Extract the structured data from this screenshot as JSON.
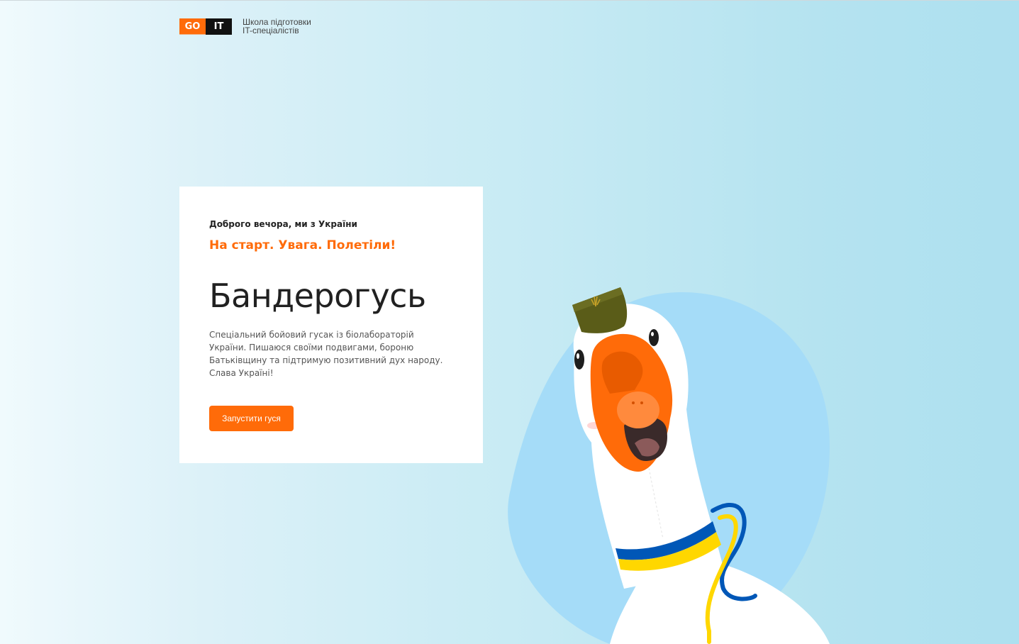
{
  "header": {
    "logo_go": "GO",
    "logo_it": "IT",
    "tagline_line1": "Школа підготовки",
    "tagline_line2": "IT-спеціалістів"
  },
  "hero": {
    "greeting": "Доброго вечора, ми з України",
    "slogan": "На старт. Увага. Полетіли!",
    "title": "Бандерогусь",
    "description": "Спеціальний бойовий гусак із біолабораторій України. Пишаюся своїми подвигами, бороню Батьківщину та підтримую позитивний дух народу. Слава Україні!",
    "button_label": "Запустити гуся"
  },
  "colors": {
    "accent": "#ff6b09",
    "ua_blue": "#0057b7",
    "ua_yellow": "#ffd700"
  }
}
